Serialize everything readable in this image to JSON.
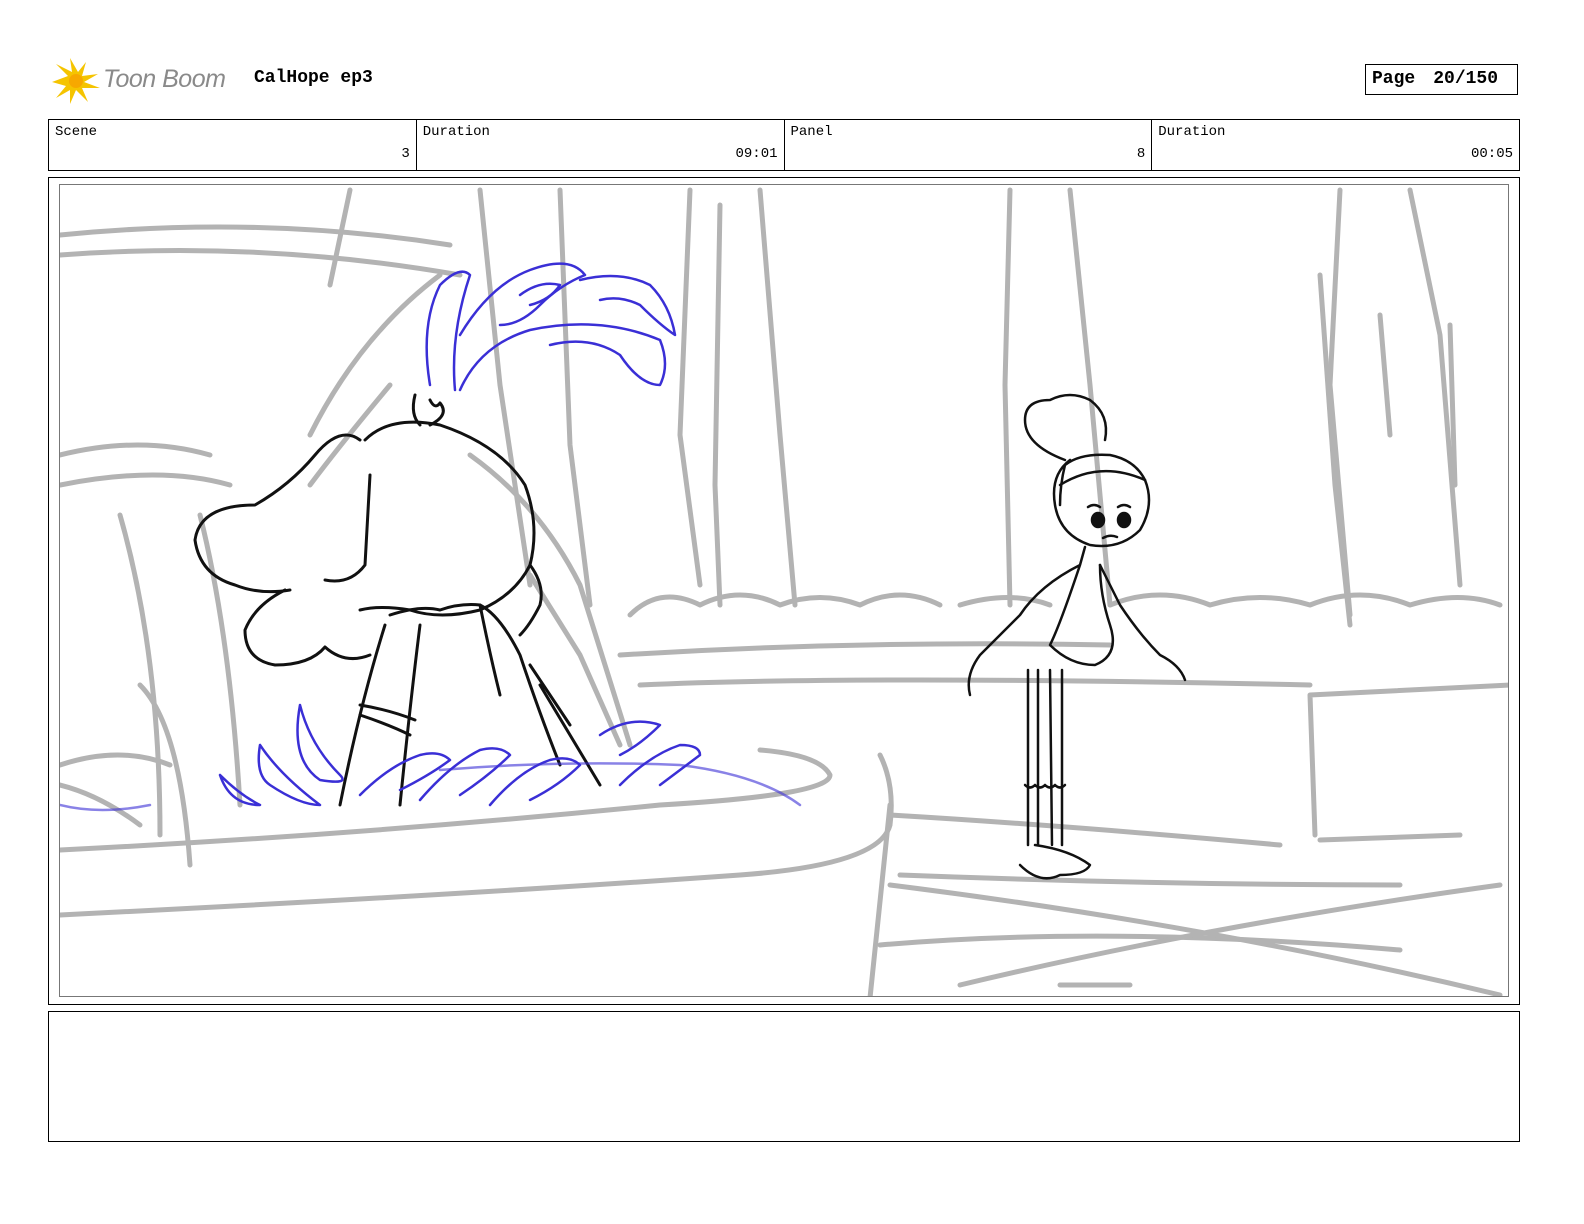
{
  "header": {
    "logo_text": "Toon Boom",
    "project_title": "CalHope ep3",
    "page_label": "Page",
    "page_number": "20/150"
  },
  "info": {
    "scene_label": "Scene",
    "scene_value": "3",
    "scene_duration_label": "Duration",
    "scene_duration_value": "09:01",
    "panel_label": "Panel",
    "panel_value": "8",
    "panel_duration_label": "Duration",
    "panel_duration_value": "00:05"
  },
  "panel": {
    "image_subject": "storyboard-sketch"
  },
  "notes": {
    "text": ""
  },
  "colors": {
    "sketch_gray": "#b3b3b3",
    "ink_black": "#111111",
    "water_blue": "#3a2fd6",
    "logo_yellow": "#f5c400"
  }
}
